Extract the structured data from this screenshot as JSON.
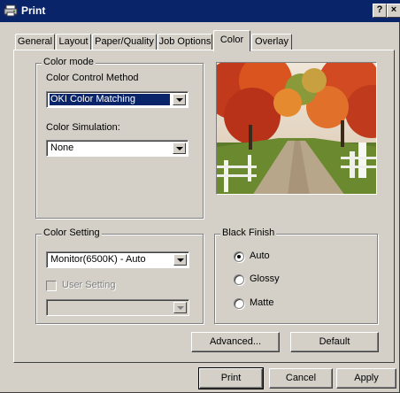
{
  "window": {
    "title": "Print",
    "help_btn": "?",
    "close_btn": "×"
  },
  "tabs": [
    {
      "label": "General",
      "active": false
    },
    {
      "label": "Layout",
      "active": false
    },
    {
      "label": "Paper/Quality",
      "active": false
    },
    {
      "label": "Job Options",
      "active": false
    },
    {
      "label": "Color",
      "active": true
    },
    {
      "label": "Overlay",
      "active": false
    }
  ],
  "color_mode": {
    "group_title": "Color mode",
    "method_label": "Color Control Method",
    "method_value": "OKI Color Matching",
    "simulation_label": "Color Simulation:",
    "simulation_value": "None"
  },
  "color_setting": {
    "group_title": "Color Setting",
    "value": "Monitor(6500K) - Auto",
    "user_setting_label": "User Setting",
    "user_setting_checked": false,
    "user_setting_value": ""
  },
  "black_finish": {
    "group_title": "Black Finish",
    "options": [
      "Auto",
      "Glossy",
      "Matte"
    ],
    "selected": "Auto"
  },
  "buttons": {
    "advanced": "Advanced...",
    "default": "Default",
    "print": "Print",
    "cancel": "Cancel",
    "apply": "Apply"
  },
  "colors": {
    "titlebar": "#0a246a",
    "face": "#d4d0c8",
    "selection": "#0a246a"
  }
}
